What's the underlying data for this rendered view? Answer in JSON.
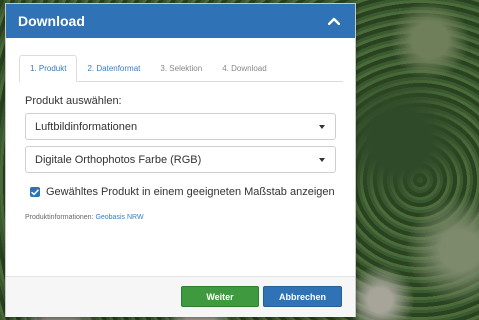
{
  "panel": {
    "title": "Download"
  },
  "tabs": [
    {
      "label": "1. Produkt",
      "state": "active"
    },
    {
      "label": "2. Datenformat",
      "state": "enabled"
    },
    {
      "label": "3. Selektion",
      "state": "disabled"
    },
    {
      "label": "4. Download",
      "state": "disabled"
    }
  ],
  "form": {
    "select_label": "Produkt auswählen:",
    "product_category": "Luftbildinformationen",
    "product": "Digitale Orthophotos Farbe (RGB)",
    "checkbox_label": "Gewähltes Produkt in einem geeigneten Maßstab anzeigen",
    "checkbox_checked": true,
    "info_prefix": "Produktinformationen:",
    "info_link": "Geobasis NRW"
  },
  "footer": {
    "next_label": "Weiter",
    "cancel_label": "Abbrechen"
  },
  "colors": {
    "header": "#2f73b6",
    "next_button": "#3f9a3f",
    "cancel_button": "#2f73b6",
    "link": "#3a7bc8"
  },
  "icons": {
    "collapse": "chevron-up-icon",
    "dropdown": "caret-down-icon",
    "checkbox": "check-icon"
  }
}
